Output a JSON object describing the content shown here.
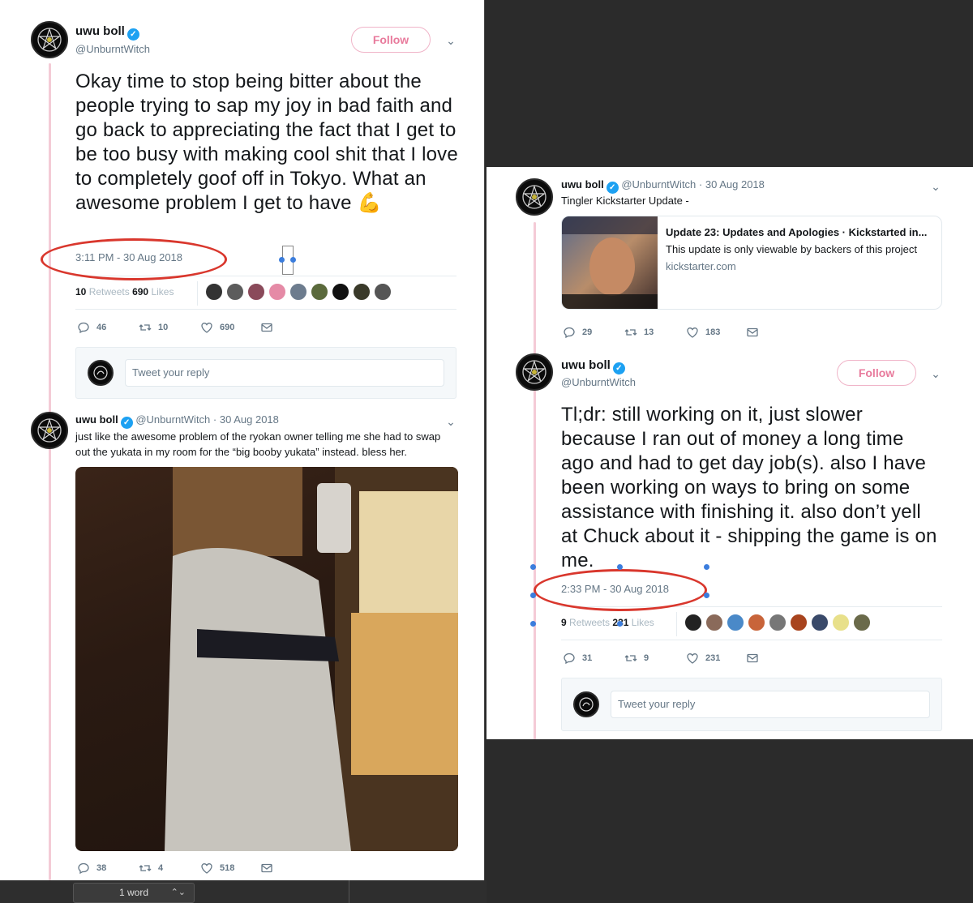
{
  "colors": {
    "thread_line": "#f4cbd6",
    "follow_pink": "#e0245e",
    "verified_blue": "#1da1f2",
    "annotation_red": "#d9372d",
    "muted": "#657786"
  },
  "left_panel": {
    "tweet1": {
      "name": "uwu boll",
      "handle": "@UnburntWitch",
      "follow_label": "Follow",
      "text": "Okay time to stop being bitter about the people trying to sap my joy in bad faith and go back to appreciating the fact that I get to be too busy with making cool shit that I love to completely goof off in Tokyo. What an awesome problem I get to have 💪",
      "timestamp": "3:11 PM - 30 Aug 2018",
      "retweets_count": "10",
      "retweets_label": "Retweets",
      "likes_count": "690",
      "likes_label": "Likes",
      "replies": "46",
      "rts": "10",
      "likes": "690",
      "reply_placeholder": "Tweet your reply"
    },
    "tweet2": {
      "name": "uwu boll",
      "handle": "@UnburntWitch",
      "date": "· 30 Aug 2018",
      "text": "just like the awesome problem of the ryokan owner telling me she had to swap out the yukata in my room for the “big booby yukata” instead. bless her.",
      "replies": "38",
      "rts": "4",
      "likes": "518"
    }
  },
  "right_panel": {
    "tweet1": {
      "name": "uwu boll",
      "handle": "@UnburntWitch",
      "date": "· 30 Aug 2018",
      "text": "Tingler Kickstarter Update -",
      "card_title": "Update 23: Updates and Apologies · Kickstarted in...",
      "card_desc": "This update is only viewable by backers of this project",
      "card_domain": "kickstarter.com",
      "replies": "29",
      "rts": "13",
      "likes": "183"
    },
    "tweet2": {
      "name": "uwu boll",
      "handle": "@UnburntWitch",
      "follow_label": "Follow",
      "text": "Tl;dr: still working on it, just slower because I ran out of money a long time ago and had to get day job(s). also I have been working on ways to bring on some assistance with finishing it. also don’t yell at Chuck about it - shipping the game is on me.",
      "timestamp": "2:33 PM - 30 Aug 2018",
      "retweets_count": "9",
      "retweets_label": "Retweets",
      "likes_count": "231",
      "likes_label": "Likes",
      "replies": "31",
      "rts": "9",
      "likes": "231",
      "reply_placeholder": "Tweet your reply"
    }
  },
  "status_bar": {
    "word_count": "1 word"
  }
}
